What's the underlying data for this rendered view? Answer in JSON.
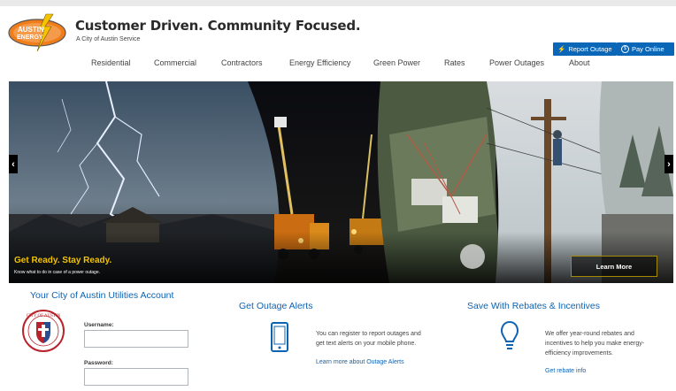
{
  "header": {
    "logo_text_top": "AUSTIN",
    "logo_text_bottom": "ENERGY",
    "tagline": "Customer Driven. Community Focused.",
    "subtagline": "A City of Austin Service",
    "report_outage_label": "Report Outage",
    "pay_online_label": "Pay Online"
  },
  "nav": {
    "items": [
      "Residential",
      "Commercial",
      "Contractors",
      "Energy Efficiency",
      "Green Power",
      "Rates",
      "Power Outages",
      "About"
    ]
  },
  "hero": {
    "title": "Get Ready. Stay Ready.",
    "subtitle": "Know what to do in case of a power outage.",
    "button_label": "Learn More",
    "prev_arrow": "‹",
    "next_arrow": "›"
  },
  "account": {
    "title": "Your City of Austin Utilities Account",
    "seal_text": "CITY OF AUSTIN",
    "username_label": "Username:",
    "password_label": "Password:",
    "username_value": "",
    "password_value": ""
  },
  "outage_alerts": {
    "title": "Get Outage Alerts",
    "text_line1": "You can register to report outages and",
    "text_line2": "get text alerts on your mobile phone.",
    "link": "Learn more about Outage Alerts"
  },
  "rebates": {
    "title": "Save With Rebates & Incentives",
    "text_line1": "We offer year-round rebates and",
    "text_line2": "incentives to help you make energy-",
    "text_line3": "efficiency improvements.",
    "link": "Get rebate info"
  },
  "colors": {
    "brand_blue": "#0d63b2",
    "button_blue": "#0a67b8",
    "accent_yellow": "#f3c200",
    "logo_orange": "#f07d1a"
  },
  "icons": {
    "outage_button_icon": "lightning-icon",
    "pay_button_icon": "dollar-circle-icon",
    "outage_section_icon": "mobile-phone-icon",
    "rebate_section_icon": "lightbulb-icon"
  }
}
